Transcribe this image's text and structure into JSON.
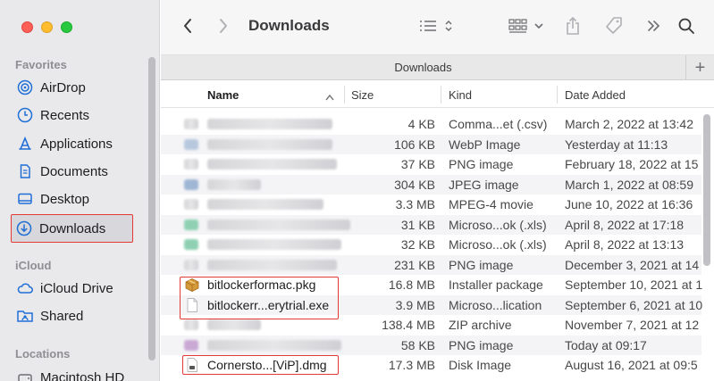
{
  "window": {
    "title": "Downloads",
    "path_tab": "Downloads"
  },
  "sidebar": {
    "sections": [
      {
        "label": "Favorites",
        "items": [
          {
            "label": "AirDrop",
            "icon": "airdrop-icon"
          },
          {
            "label": "Recents",
            "icon": "clock-icon"
          },
          {
            "label": "Applications",
            "icon": "applications-icon"
          },
          {
            "label": "Documents",
            "icon": "document-icon"
          },
          {
            "label": "Desktop",
            "icon": "desktop-icon"
          },
          {
            "label": "Downloads",
            "icon": "download-icon",
            "selected": true
          }
        ]
      },
      {
        "label": "iCloud",
        "items": [
          {
            "label": "iCloud Drive",
            "icon": "cloud-icon"
          },
          {
            "label": "Shared",
            "icon": "shared-folder-icon"
          }
        ]
      },
      {
        "label": "Locations",
        "items": [
          {
            "label": "Macintosh HD",
            "icon": "disk-icon"
          }
        ]
      }
    ]
  },
  "columns": {
    "name": "Name",
    "size": "Size",
    "kind": "Kind",
    "date": "Date Added"
  },
  "files": [
    {
      "name": "",
      "size": "4 KB",
      "kind": "Comma...et (.csv)",
      "date": "March 2, 2022 at 13:42"
    },
    {
      "name": "",
      "size": "106 KB",
      "kind": "WebP Image",
      "date": "Yesterday at 11:13"
    },
    {
      "name": "",
      "size": "37 KB",
      "kind": "PNG image",
      "date": "February 18, 2022 at 15"
    },
    {
      "name": "",
      "size": "304 KB",
      "kind": "JPEG image",
      "date": "March 1, 2022 at 08:59"
    },
    {
      "name": "",
      "size": "3.3 MB",
      "kind": "MPEG-4 movie",
      "date": "June 10, 2022 at 16:36"
    },
    {
      "name": "",
      "size": "31 KB",
      "kind": "Microso...ok (.xls)",
      "date": "April 8, 2022 at 17:18"
    },
    {
      "name": "",
      "size": "32 KB",
      "kind": "Microso...ok (.xls)",
      "date": "April 8, 2022 at 13:13"
    },
    {
      "name": "",
      "size": "231 KB",
      "kind": "PNG image",
      "date": "December 3, 2021 at 14"
    },
    {
      "name": "bitlockerformac.pkg",
      "size": "16.8 MB",
      "kind": "Installer package",
      "date": "September 10, 2021 at 1"
    },
    {
      "name": "bitlockerr...erytrial.exe",
      "size": "3.9 MB",
      "kind": "Microso...lication",
      "date": "September 6, 2021 at 10"
    },
    {
      "name": "",
      "size": "138.4 MB",
      "kind": "ZIP archive",
      "date": "November 7, 2021 at 12"
    },
    {
      "name": "",
      "size": "58 KB",
      "kind": "PNG image",
      "date": "Today at 09:17"
    },
    {
      "name": "Cornersto...[ViP].dmg",
      "size": "17.3 MB",
      "kind": "Disk Image",
      "date": "August 16, 2021 at 09:5"
    }
  ],
  "colors": {
    "highlight": "#e53935",
    "accent": "#1f6fd6"
  }
}
